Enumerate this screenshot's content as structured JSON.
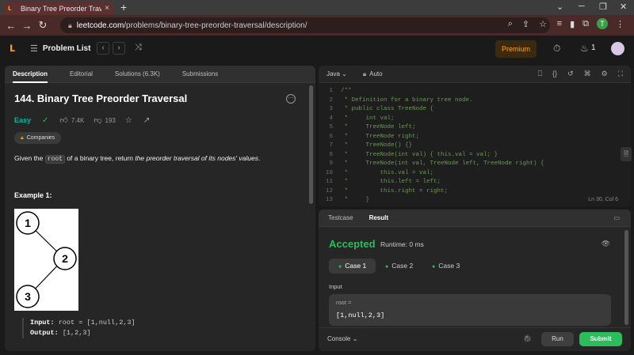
{
  "browser": {
    "tab_title": "Binary Tree Preorder Traversal - L",
    "tab_close": "×",
    "new_tab": "+",
    "url_host": "leetcode.com",
    "url_path": "/problems/binary-tree-preorder-traversal/description/",
    "profile_initial": "T"
  },
  "header": {
    "problem_list": "Problem List",
    "premium": "Premium",
    "streak": "1"
  },
  "left": {
    "tabs": [
      "Description",
      "Editorial",
      "Solutions (6.3K)",
      "Submissions"
    ],
    "title": "144. Binary Tree Preorder Traversal",
    "difficulty": "Easy",
    "likes": "7.4K",
    "dislikes": "193",
    "companies": "Companies",
    "desc_before": "Given the ",
    "desc_code": "root",
    "desc_middle": " of a binary tree, return ",
    "desc_em": "the preorder traversal of its nodes' values",
    "desc_end": ".",
    "example_title": "Example 1:",
    "tree_nodes": [
      "1",
      "2",
      "3"
    ],
    "input_label": "Input:",
    "input_value": " root = [1,null,2,3]",
    "output_label": "Output:",
    "output_value": " [1,2,3]"
  },
  "editor": {
    "language": "Java",
    "mode": "Auto",
    "lines": [
      {
        "n": "1",
        "t": "/**"
      },
      {
        "n": "2",
        "t": " * Definition for a binary tree node."
      },
      {
        "n": "3",
        "t": " * public class TreeNode {"
      },
      {
        "n": "4",
        "t": " *     int val;"
      },
      {
        "n": "5",
        "t": " *     TreeNode left;"
      },
      {
        "n": "6",
        "t": " *     TreeNode right;"
      },
      {
        "n": "7",
        "t": " *     TreeNode() {}"
      },
      {
        "n": "8",
        "t": " *     TreeNode(int val) { this.val = val; }"
      },
      {
        "n": "9",
        "t": " *     TreeNode(int val, TreeNode left, TreeNode right) {"
      },
      {
        "n": "10",
        "t": " *         this.val = val;"
      },
      {
        "n": "11",
        "t": " *         this.left = left;"
      },
      {
        "n": "12",
        "t": " *         this.right = right;"
      },
      {
        "n": "13",
        "t": " *     }"
      }
    ],
    "cursor": "Ln 30, Col 6"
  },
  "result": {
    "tabs": [
      "Testcase",
      "Result"
    ],
    "status": "Accepted",
    "runtime": "Runtime: 0 ms",
    "cases": [
      "Case 1",
      "Case 2",
      "Case 3"
    ],
    "input_label": "Input",
    "var_name": "root =",
    "var_value": "[1,null,2,3]",
    "console": "Console",
    "run": "Run",
    "submit": "Submit"
  },
  "colors": {
    "accepted": "#2cbb5d",
    "easy": "#00b8a3",
    "brand": "#ffa116"
  }
}
